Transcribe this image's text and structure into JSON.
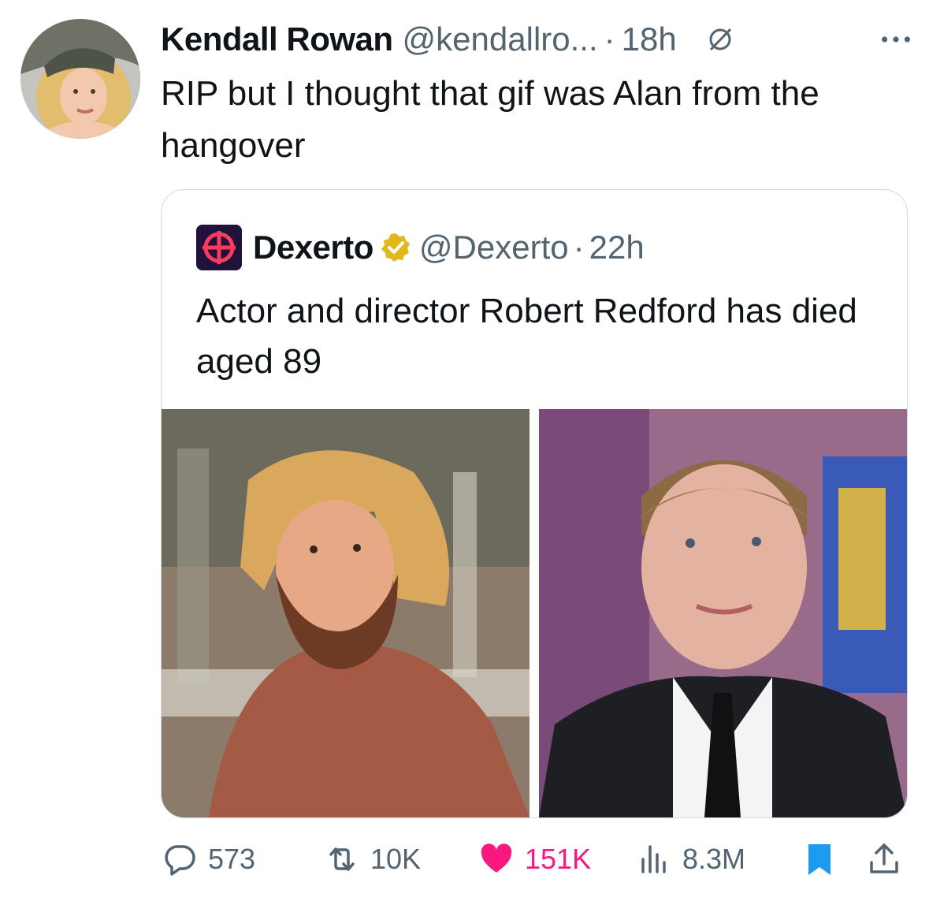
{
  "tweet": {
    "author_name": "Kendall Rowan",
    "author_handle": "@kendallro...",
    "separator": "·",
    "time": "18h",
    "text": "RIP but I thought that gif was Alan from the hangover"
  },
  "quote": {
    "author_name": "Dexerto",
    "author_handle": "@Dexerto",
    "separator": "·",
    "time": "22h",
    "text": "Actor and director Robert Redford has died aged 89"
  },
  "actions": {
    "replies": "573",
    "reposts": "10K",
    "likes": "151K",
    "views": "8.3M"
  },
  "colors": {
    "like": "#f91880",
    "bookmark": "#1d9bf0",
    "verified": "#e2b719",
    "muted": "#536471"
  },
  "icons": [
    "grok-icon",
    "more-icon",
    "verified-gold-icon",
    "reply-icon",
    "repost-icon",
    "heart-icon",
    "views-icon",
    "bookmark-icon",
    "share-icon"
  ]
}
